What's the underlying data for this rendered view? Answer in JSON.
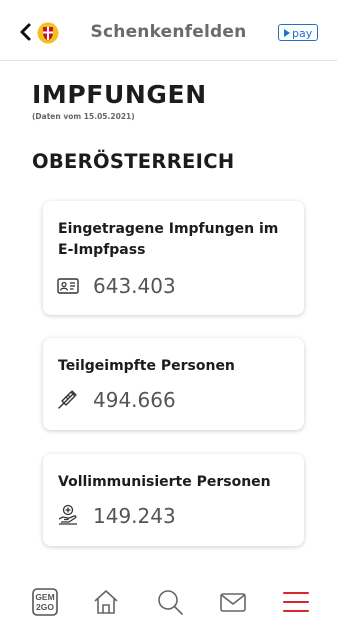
{
  "header": {
    "town": "Schenkenfelden",
    "pay_label": "pay"
  },
  "page": {
    "title": "IMPFUNGEN",
    "date_note": "(Daten vom 15.05.2021)",
    "region": "OBERÖSTERREICH"
  },
  "cards": [
    {
      "title": "Eingetragene Impfungen im E-Impfpass",
      "value": "643.403",
      "icon": "id-card-icon"
    },
    {
      "title": "Teilgeimpfte Personen",
      "value": "494.666",
      "icon": "syringe-icon"
    },
    {
      "title": "Vollimmunisierte Personen",
      "value": "149.243",
      "icon": "hand-health-icon"
    }
  ],
  "tabbar": {
    "logo_line1": "GEM",
    "logo_line2": "2GO",
    "active_color": "#d9262e",
    "icons": [
      "gem2go-logo-icon",
      "home-icon",
      "search-icon",
      "mail-icon",
      "menu-icon"
    ]
  }
}
